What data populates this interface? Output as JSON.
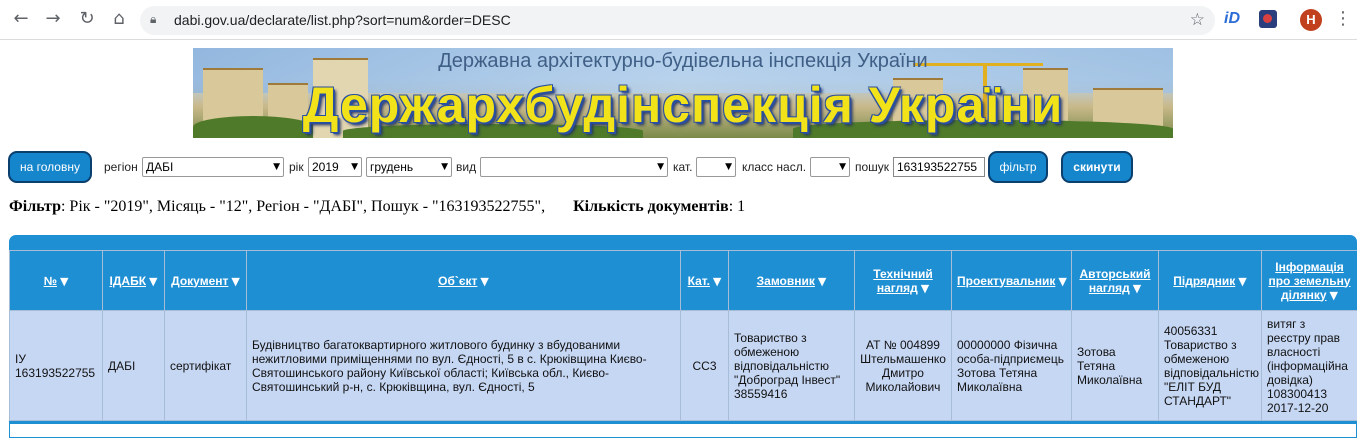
{
  "browser": {
    "url": "dabi.gov.ua/declarate/list.php?sort=num&order=DESC",
    "extension_label": "iD",
    "avatar_letter": "H"
  },
  "banner": {
    "subtitle": "Державна архітектурно-будівельна інспекція України",
    "title": "Держархбудінспекція України"
  },
  "filters": {
    "home_button": "на головну",
    "region_label": "регіон",
    "region_value": "ДАБІ",
    "year_label": "рік",
    "year_value": "2019",
    "month_value": "грудень",
    "type_label": "вид",
    "type_value": "",
    "cat_label": "кат.",
    "cat_value": "",
    "class_label": "класс насл.",
    "class_value": "",
    "search_label": "пошук",
    "search_value": "163193522755",
    "filter_button": "фільтр",
    "reset_button": "скинути"
  },
  "summary": {
    "filter_label": "Фільтр",
    "filter_text": ": Рік - \"2019\", Місяць - \"12\", Регіон - \"ДАБІ\", Пошук - \"163193522755\",",
    "count_label": "Кількість документів",
    "count_text": ": 1"
  },
  "table": {
    "headers": [
      "№",
      "ІДАБК",
      "Документ",
      "Об`єкт",
      "Кат.",
      "Замовник",
      "Технічний нагляд",
      "Проектувальник",
      "Авторський нагляд",
      "Підрядник",
      "Інформація про земельну ділянку"
    ],
    "sort_arrow": "▼",
    "rows": [
      {
        "num": "ІУ 163193522755",
        "idabk": "ДАБІ",
        "doc": "сертифікат",
        "object": "Будівництво багатоквартирного житлового будинку з вбудованими нежитловими приміщеннями по вул. Єдності, 5 в с. Крюківщина Києво-Святошинського району Київської області; Київська обл., Києво-Святошинський р-н, с. Крюківщина, вул. Єдності, 5",
        "cat": "СС3",
        "customer": "Товариство з обмеженою відповідальністю \"Доброград Інвест\" 38559416",
        "tech": "АТ № 004899 Штельмашенко Дмитро Миколайович",
        "designer": "00000000 Фізична особа-підприємець Зотова Тетяна Миколаївна",
        "author": "Зотова Тетяна Миколаївна",
        "contractor": "40056331 Товариство з обмеженою відповідальністю \"ЕЛІТ БУД СТАНДАРТ\"",
        "land": "витяг з реєстру прав власності (інформаційна довідка) 108300413 2017-12-20"
      }
    ]
  }
}
